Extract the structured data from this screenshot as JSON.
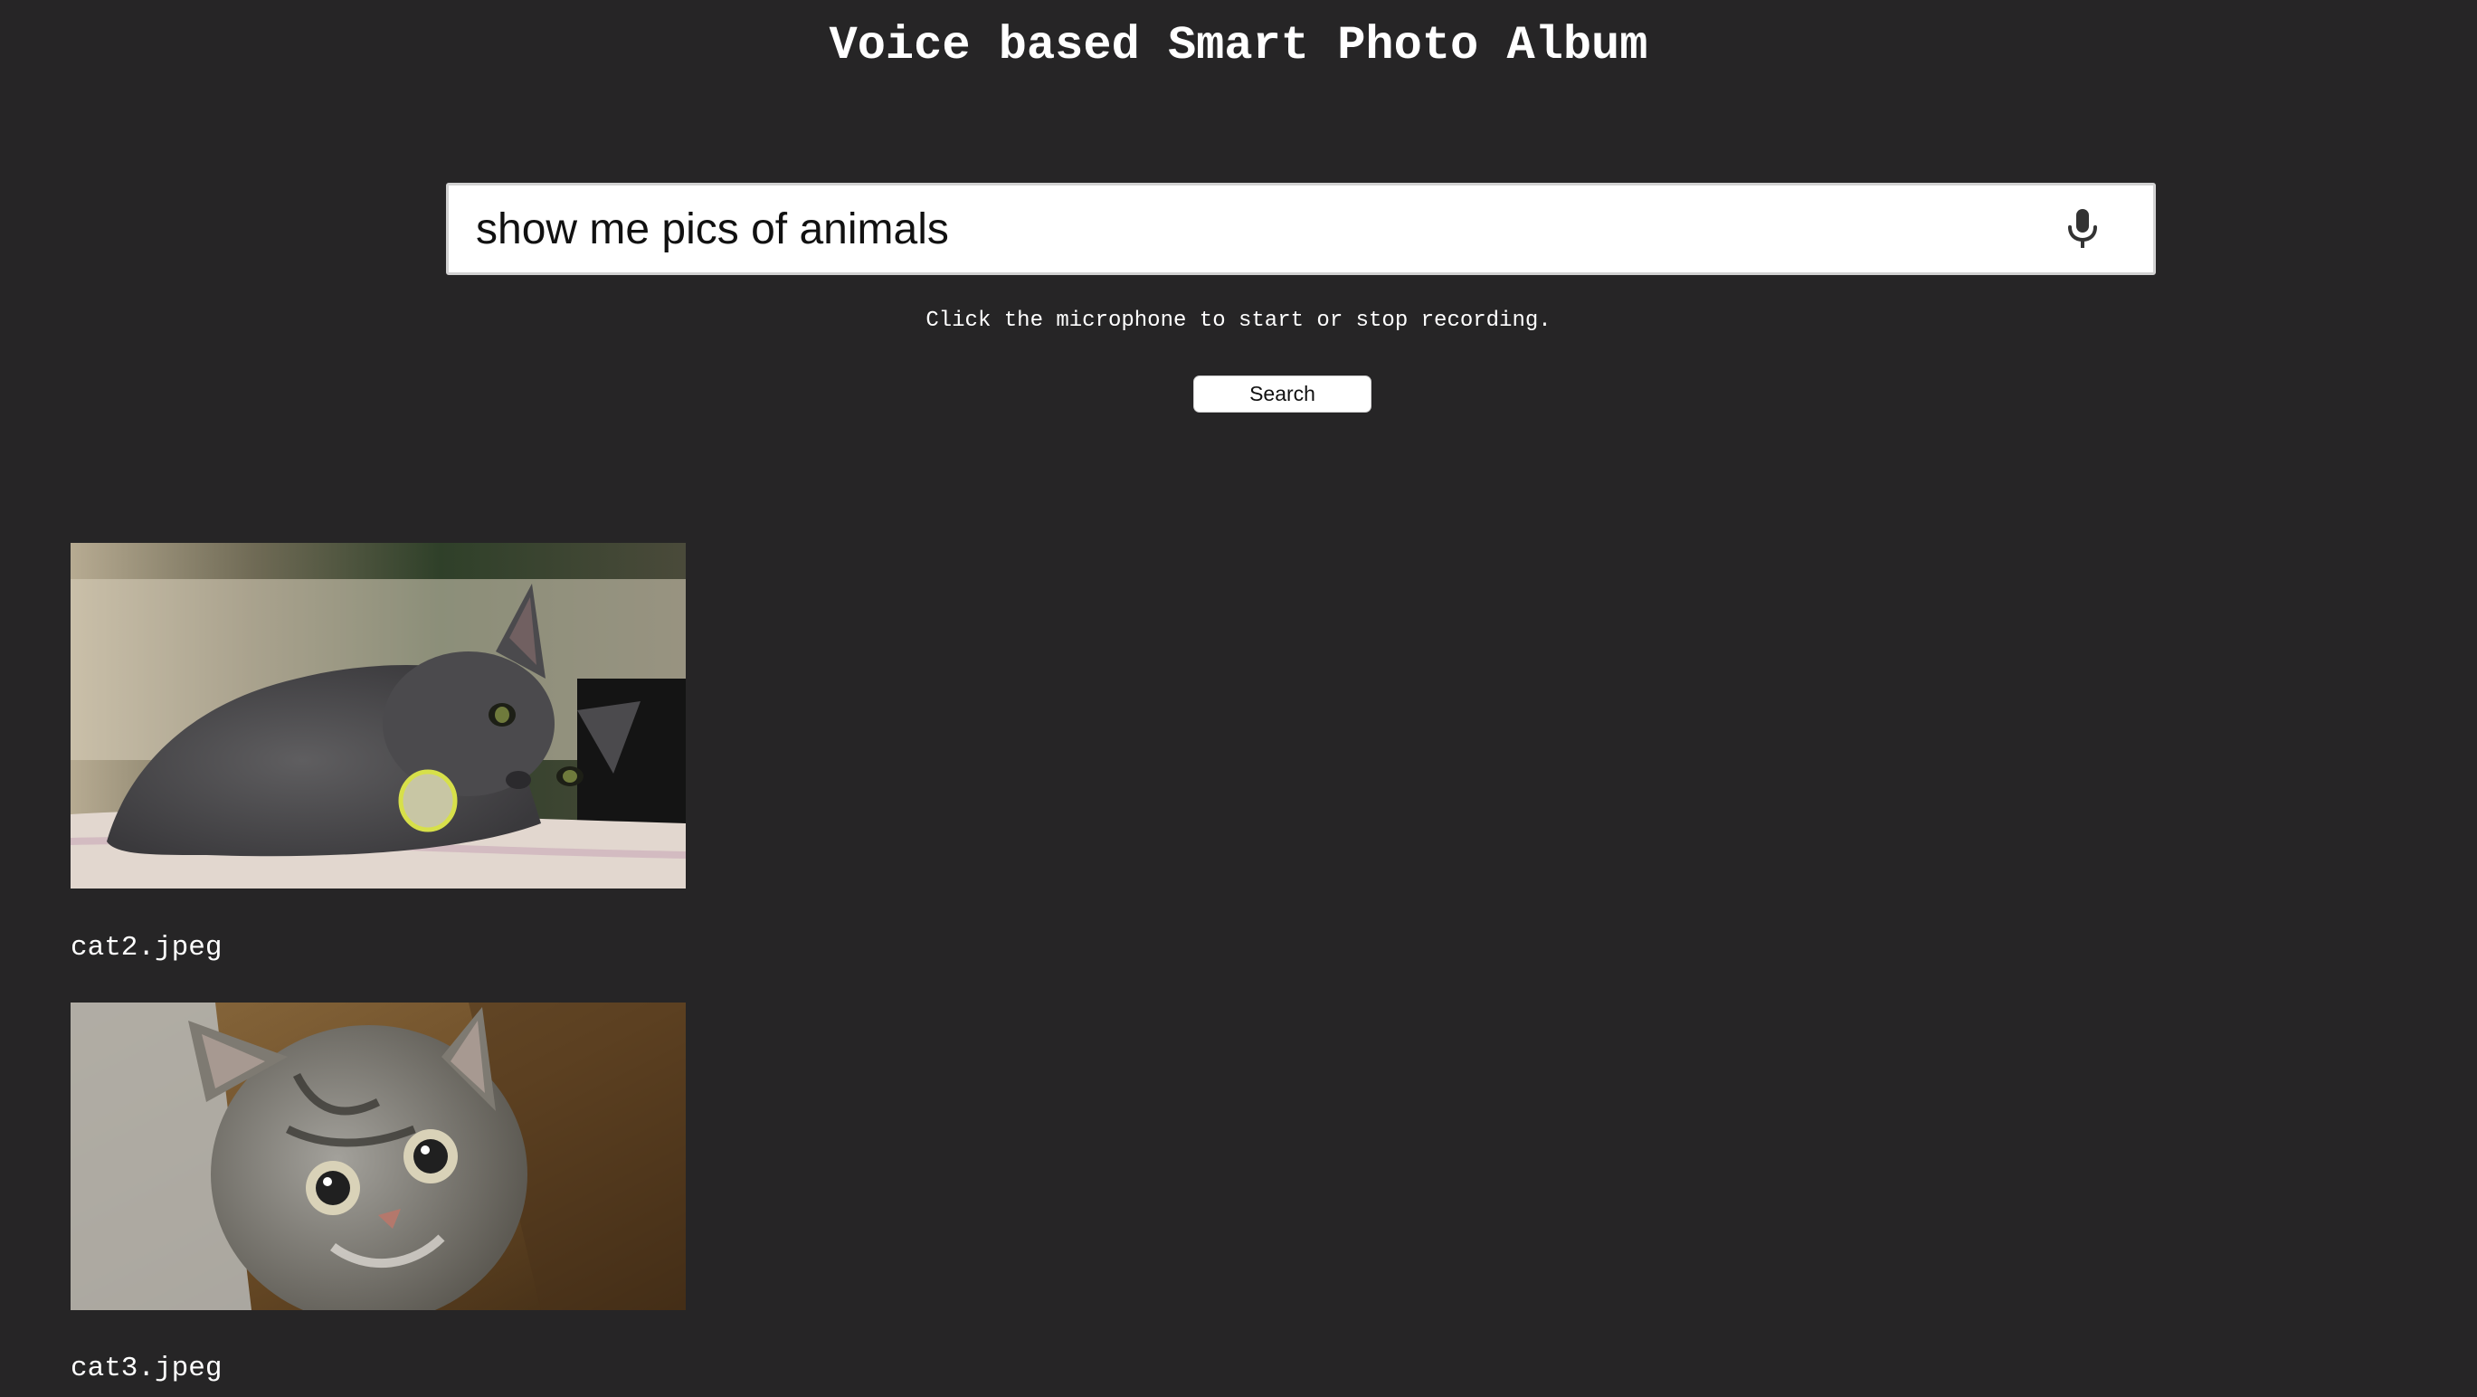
{
  "header": {
    "title": "Voice based Smart Photo Album"
  },
  "search": {
    "query": "show me pics of animals",
    "mic_icon": "microphone-icon",
    "hint": "Click the microphone to start or stop recording.",
    "button_label": "Search"
  },
  "results": [
    {
      "filename": "cat2.jpeg",
      "subject": "gray cat lying on a cushion"
    },
    {
      "filename": "cat3.jpeg",
      "subject": "tabby kitten looking up"
    }
  ],
  "colors": {
    "background": "#262526",
    "text": "#ffffff",
    "input_background": "#ffffff"
  }
}
